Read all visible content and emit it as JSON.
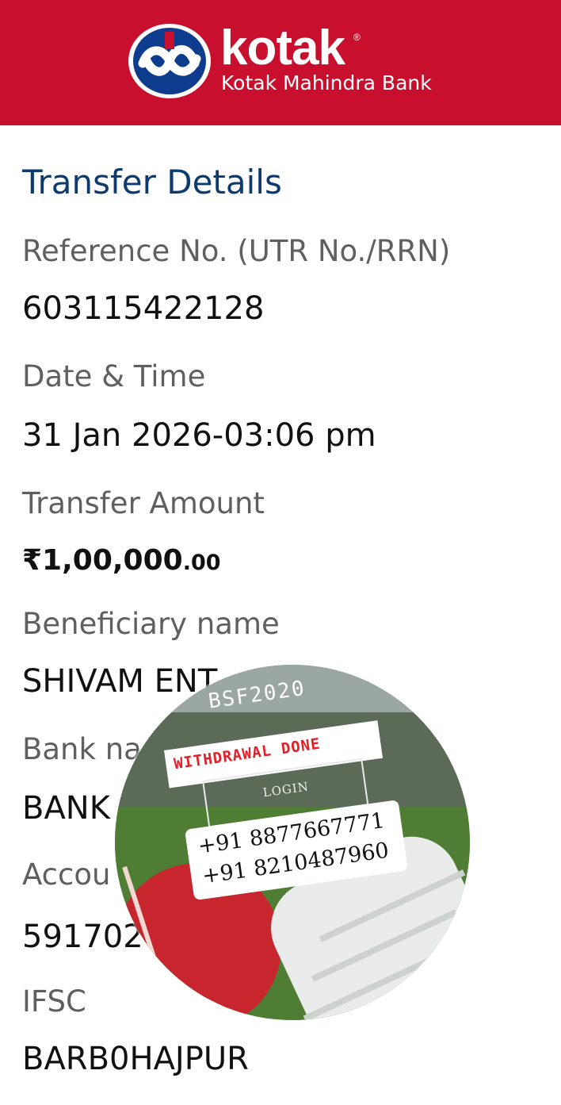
{
  "header": {
    "brand_name": "kotak",
    "registered_mark": "®",
    "brand_subtitle": "Kotak Mahindra Bank",
    "background_color": "#c8102e",
    "logo_icon": "kotak-infinity-logo-icon"
  },
  "main": {
    "section_title": "Transfer Details",
    "fields": [
      {
        "label": "Reference No. (UTR No./RRN)",
        "value": "603115422128"
      },
      {
        "label": "Date & Time",
        "value": "31 Jan 2026-03:06 pm"
      },
      {
        "label": "Transfer Amount",
        "value_main": "₹1,00,000",
        "value_decimal": ".00"
      },
      {
        "label": "Beneficiary name",
        "value": "SHIVAM ENT"
      },
      {
        "label": "Bank na",
        "value": "BANK"
      },
      {
        "label": "Accou",
        "value": "591702"
      },
      {
        "label": "IFSC",
        "value": "BARB0HAJPUR"
      }
    ],
    "title_color": "#0d3b6e"
  },
  "sticker": {
    "title": "BSF2020",
    "banner": "WITHDRAWAL DONE",
    "login_label": "LOGIN",
    "phones": [
      "+91 8877667771",
      "+91 8210487960"
    ],
    "banner_color": "#e2202a"
  }
}
